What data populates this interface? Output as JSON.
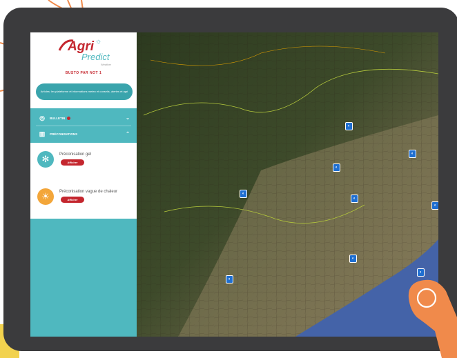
{
  "brand": {
    "logo_agri": "Agri",
    "logo_predict": "Predict",
    "logo_sub": "Weather",
    "tagline": "BUSTO PAR NOT 1"
  },
  "info_banner": {
    "text": "Articles: les plateforme et informations meteo et conseils, alertes et agri"
  },
  "menu": {
    "bulletin_label": "BULLETIN",
    "preconisations_label": "PRÉCONISATIONS"
  },
  "cards": [
    {
      "title": "Préconisation gel",
      "button": "Afficher",
      "icon": "snowflake-icon",
      "color": "#4fb8bf"
    },
    {
      "title": "Préconisation vague de chaleur",
      "button": "Afficher",
      "icon": "sun-icon",
      "color": "#f3a63a"
    }
  ],
  "colors": {
    "accent": "#4fb8bf",
    "brand_red": "#c4262e",
    "tablet_frame": "#3b3b3d",
    "hand": "#f08a4b",
    "pin": "#1f6fd1"
  },
  "map": {
    "pin_icon": "weather-station-icon"
  }
}
